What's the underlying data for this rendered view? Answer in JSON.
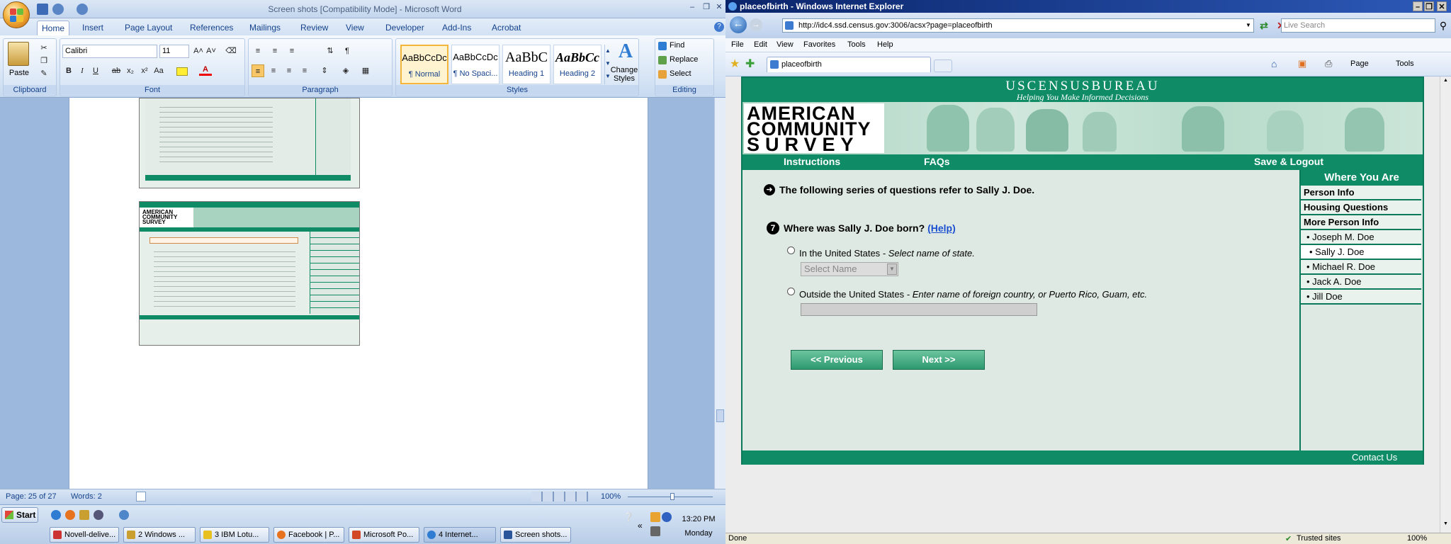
{
  "word": {
    "title": "Screen shots [Compatibility Mode] - Microsoft Word",
    "tabs": [
      "Home",
      "Insert",
      "Page Layout",
      "References",
      "Mailings",
      "Review",
      "View",
      "Developer",
      "Add-Ins",
      "Acrobat"
    ],
    "font": "Calibri",
    "font_size": "11",
    "groups": {
      "clipboard": "Clipboard",
      "font": "Font",
      "paragraph": "Paragraph",
      "styles": "Styles",
      "editing": "Editing"
    },
    "paste_label": "Paste",
    "styles": [
      {
        "preview": "AaBbCcDc",
        "label": "¶ Normal"
      },
      {
        "preview": "AaBbCcDc",
        "label": "¶ No Spaci..."
      },
      {
        "preview": "AaBbC",
        "label": "Heading 1"
      },
      {
        "preview": "AaBbCc",
        "label": "Heading 2"
      }
    ],
    "change_styles": "Change Styles",
    "editing": {
      "find": "Find",
      "replace": "Replace",
      "select": "Select"
    },
    "status": {
      "page": "Page: 25 of 27",
      "words": "Words: 2",
      "zoom": "100%"
    }
  },
  "taskbar": {
    "start": "Start",
    "clock": "13:20 PM",
    "day": "Monday",
    "tasks": [
      "Novell-delive...",
      "2 Windows ...",
      "3 IBM Lotu...",
      "Facebook | P...",
      "Microsoft Po...",
      "4 Internet...",
      "Screen shots..."
    ]
  },
  "ie": {
    "title": "placeofbirth - Windows Internet Explorer",
    "url": "http://idc4.ssd.census.gov:3006/acsx?page=placeofbirth",
    "search_placeholder": "Live Search",
    "menus": [
      "File",
      "Edit",
      "View",
      "Favorites",
      "Tools",
      "Help"
    ],
    "tab": "placeofbirth",
    "cmd": {
      "page": "Page",
      "tools": "Tools"
    },
    "status": {
      "done": "Done",
      "zone": "Trusted sites",
      "zoom": "100%"
    }
  },
  "census": {
    "bureau": "USCENSUSBUREAU",
    "tagline": "Helping You Make Informed Decisions",
    "logo": [
      "AMERICAN",
      "COMMUNITY",
      "SURVEY"
    ],
    "nav": {
      "instructions": "Instructions",
      "faqs": "FAQs",
      "logout": "Save & Logout"
    },
    "intro": "The following series of questions refer to Sally J. Doe.",
    "q_number": "7",
    "question": "Where was Sally J. Doe born?",
    "help": "(Help)",
    "opt1": {
      "label": "In the United States",
      "hint": " - Select name of state."
    },
    "select_placeholder": "Select Name",
    "opt2": {
      "label": "Outside the United States",
      "hint": " - Enter name of foreign country, or Puerto Rico, Guam, etc."
    },
    "prev": "<<  Previous",
    "next": "Next  >>",
    "sidebar": {
      "title": "Where You Are",
      "sections": [
        "Person Info",
        "Housing Questions",
        "More Person Info"
      ],
      "people": [
        "• Joseph M. Doe",
        "• Sally J. Doe",
        "• Michael R. Doe",
        "• Jack A. Doe",
        "• Jill Doe"
      ]
    },
    "footer": "Contact Us"
  },
  "colors": {
    "census_green": "#0f8c66",
    "word_blue": "#15428b"
  }
}
